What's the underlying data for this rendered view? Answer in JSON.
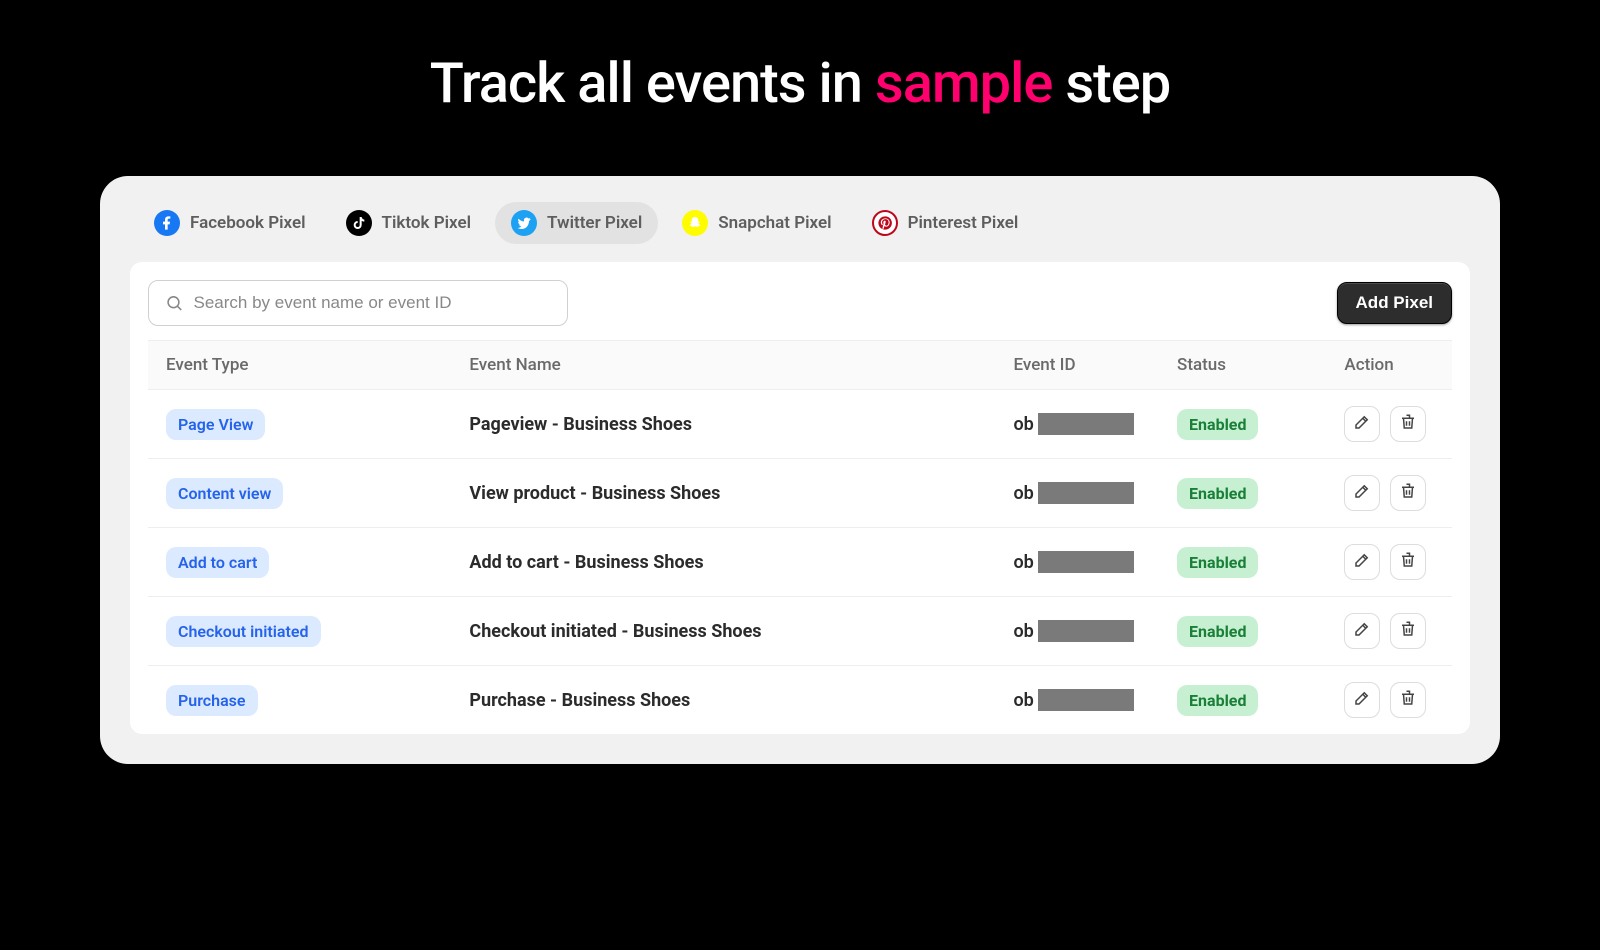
{
  "hero": {
    "pre": "Track all events in ",
    "accent": "sample",
    "post": " step"
  },
  "tabs": [
    {
      "label": "Facebook Pixel"
    },
    {
      "label": "Tiktok Pixel"
    },
    {
      "label": "Twitter Pixel"
    },
    {
      "label": "Snapchat Pixel"
    },
    {
      "label": "Pinterest Pixel"
    }
  ],
  "search": {
    "placeholder": "Search by event name or event ID"
  },
  "buttons": {
    "add_pixel": "Add Pixel"
  },
  "columns": {
    "type": "Event Type",
    "name": "Event Name",
    "id": "Event ID",
    "status": "Status",
    "action": "Action"
  },
  "rows": [
    {
      "type": "Page View",
      "name": "Pageview - Business Shoes",
      "id_prefix": "ob",
      "status": "Enabled"
    },
    {
      "type": "Content view",
      "name": "View product - Business Shoes",
      "id_prefix": "ob",
      "status": "Enabled"
    },
    {
      "type": "Add to cart",
      "name": "Add to cart - Business Shoes",
      "id_prefix": "ob",
      "status": "Enabled"
    },
    {
      "type": "Checkout initiated",
      "name": "Checkout initiated - Business Shoes",
      "id_prefix": "ob",
      "status": "Enabled"
    },
    {
      "type": "Purchase",
      "name": "Purchase - Business Shoes",
      "id_prefix": "ob",
      "status": "Enabled"
    }
  ]
}
